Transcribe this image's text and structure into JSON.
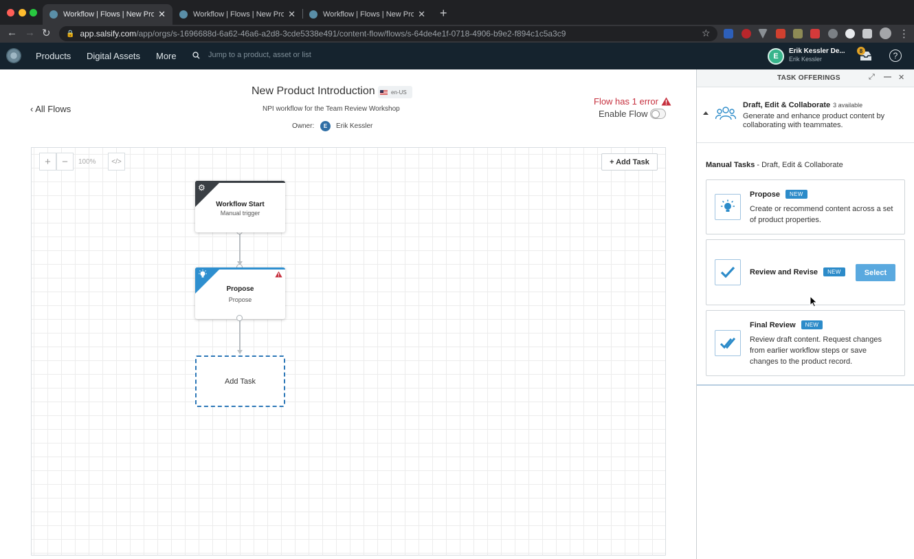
{
  "browser": {
    "tabs": [
      {
        "title": "Workflow | Flows | New Product Introduction"
      },
      {
        "title": "Workflow | Flows | New Product Introduction"
      },
      {
        "title": "Workflow | Flows | New Product Introduction"
      }
    ],
    "url_host": "app.salsify.com",
    "url_path": "/app/orgs/s-1696688d-6a62-46a6-a2d8-3cde5338e491/content-flow/flows/s-64de4e1f-0718-4906-b9e2-f894c1c5a3c9"
  },
  "appnav": {
    "items": [
      "Products",
      "Digital Assets",
      "More"
    ],
    "search_placeholder": "Jump to a product, asset or list",
    "user_initial": "E",
    "user_name": "Erik Kessler De...",
    "user_sub": "Erik Kessler",
    "notification_count": "8"
  },
  "flow": {
    "back_link": "All Flows",
    "title": "New Product Introduction",
    "locale": "en-US",
    "description": "NPI workflow for the Team Review Workshop",
    "owner_label": "Owner:",
    "owner_initial": "E",
    "owner_name": "Erik Kessler",
    "error_text": "Flow has 1 error",
    "enable_label": "Enable Flow",
    "enabled": false
  },
  "canvas": {
    "zoom_in": "+",
    "zoom_out": "−",
    "zoom_level": "100%",
    "code_label": "</>",
    "add_task_button": "+ Add Task",
    "nodes": {
      "start": {
        "title": "Workflow Start",
        "subtitle": "Manual trigger"
      },
      "propose": {
        "title": "Propose",
        "subtitle": "Propose"
      },
      "add": {
        "label": "Add Task"
      }
    }
  },
  "panel": {
    "title": "TASK OFFERINGS",
    "category": {
      "title": "Draft, Edit & Collaborate",
      "count": "3 available",
      "description": "Generate and enhance product content by collaborating with teammates."
    },
    "manual_label_bold": "Manual Tasks",
    "manual_label_rest": " - Draft, Edit & Collaborate",
    "cards": [
      {
        "title": "Propose",
        "badge": "NEW",
        "description": "Create or recommend content across a set of product properties."
      },
      {
        "title": "Review and Revise",
        "badge": "NEW",
        "button": "Select"
      },
      {
        "title": "Final Review",
        "badge": "NEW",
        "description": "Review draft content. Request changes from earlier workflow steps or save changes to the product record."
      }
    ]
  },
  "colors": {
    "accent": "#2c8bc9",
    "error": "#c6303e",
    "node_start": "#3a3f44",
    "node_propose": "#2e8fcf",
    "nav_bg": "#15232e"
  }
}
